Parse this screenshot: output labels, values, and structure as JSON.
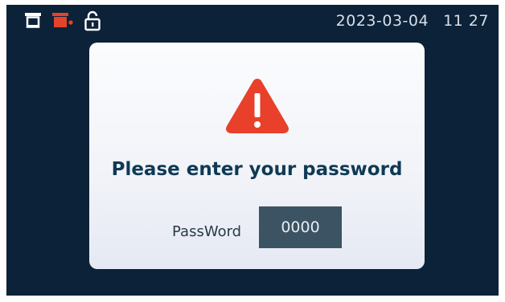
{
  "status_bar": {
    "icons": [
      "tray-icon",
      "tray-alert-icon",
      "unlock-icon"
    ],
    "date": "2023-03-04",
    "time": "11 27"
  },
  "dialog": {
    "icon": "warning-icon",
    "message": "Please enter your password",
    "password_label": "PassWord",
    "password_value": "0000"
  },
  "colors": {
    "screen_background": "#0c2238",
    "warning": "#e8402a",
    "tray_alert": "#e4432c",
    "message_text": "#0f3a55",
    "field_background": "#3c5363"
  }
}
